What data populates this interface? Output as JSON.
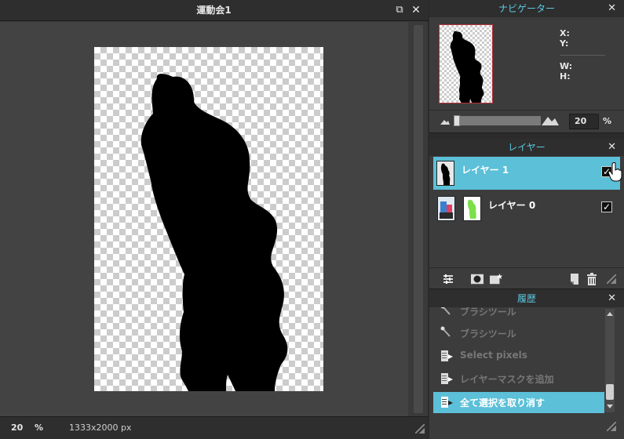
{
  "document": {
    "title": "運動会1",
    "zoom": "20",
    "zoom_unit": "%",
    "image_size": "1333x2000 px"
  },
  "navigator": {
    "title": "ナビゲーター",
    "x_label": "X:",
    "y_label": "Y:",
    "w_label": "W:",
    "h_label": "H:",
    "zoom_value": "20",
    "zoom_unit": "%",
    "zoom_slider_fraction": 0.0
  },
  "layers": {
    "title": "レイヤー",
    "items": [
      {
        "name": "レイヤー 1",
        "selected": true,
        "visible": true
      },
      {
        "name": "レイヤー 0",
        "selected": false,
        "visible": true
      }
    ]
  },
  "history": {
    "title": "履歴",
    "items": [
      {
        "label": "ブラシツール",
        "icon": "brush-icon",
        "active": false
      },
      {
        "label": "ブラシツール",
        "icon": "brush-icon",
        "active": false
      },
      {
        "label": "Select pixels",
        "icon": "history-step-icon",
        "active": false
      },
      {
        "label": "レイヤーマスクを追加",
        "icon": "history-step-icon",
        "active": false
      },
      {
        "label": "全て選択を取り消す",
        "icon": "history-step-icon",
        "active": true
      }
    ]
  },
  "colors": {
    "accent": "#5bc0d8",
    "panel_title": "#5cc8e0",
    "silhouette": "#000000"
  },
  "glyphs": {
    "close": "✕",
    "maximize": "⧉",
    "check": "✓"
  }
}
